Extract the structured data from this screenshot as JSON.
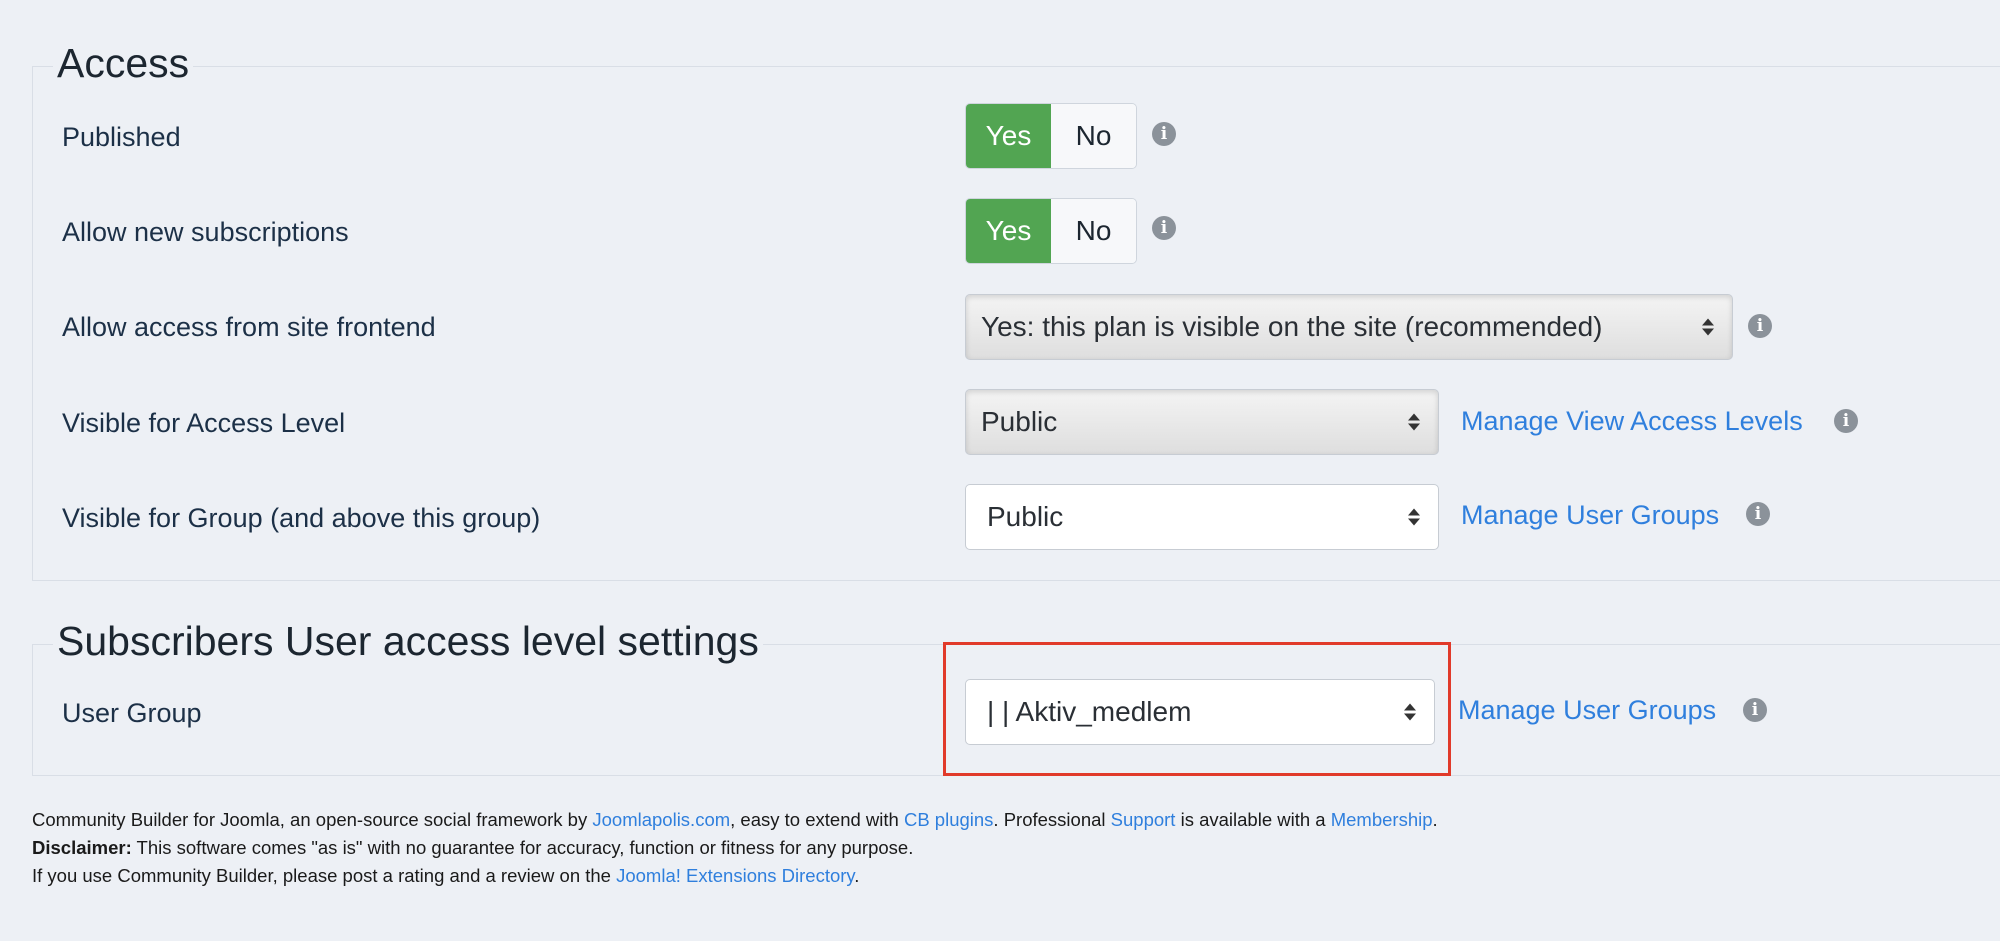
{
  "access": {
    "legend": "Access",
    "published": {
      "label": "Published",
      "yes": "Yes",
      "no": "No",
      "selected": "Yes"
    },
    "allow_new_subscriptions": {
      "label": "Allow new subscriptions",
      "yes": "Yes",
      "no": "No",
      "selected": "Yes"
    },
    "allow_access_frontend": {
      "label": "Allow access from site frontend",
      "value": "Yes: this plan is visible on the site (recommended)"
    },
    "visible_access_level": {
      "label": "Visible for Access Level",
      "value": "Public",
      "link": "Manage View Access Levels"
    },
    "visible_group": {
      "label": "Visible for Group (and above this group)",
      "value": "Public",
      "link": "Manage User Groups"
    }
  },
  "subscribers": {
    "legend": "Subscribers User access level settings",
    "user_group": {
      "label": "User Group",
      "value": "| | Aktiv_medlem",
      "link": "Manage User Groups"
    }
  },
  "footer": {
    "line1_prefix": "Community Builder for Joomla, an open-source social framework by ",
    "line1_link1": "Joomlapolis.com",
    "line1_mid1": ", easy to extend with ",
    "line1_link2": "CB plugins",
    "line1_mid2": ". Professional ",
    "line1_link3": "Support",
    "line1_mid3": " is available with a ",
    "line1_link4": "Membership",
    "line1_end": ".",
    "disclaimer_bold": "Disclaimer:",
    "disclaimer_text": " This software comes \"as is\" with no guarantee for accuracy, function or fitness for any purpose.",
    "line3_prefix": "If you use Community Builder, please post a rating and a review on the ",
    "line3_link": "Joomla! Extensions Directory",
    "line3_end": "."
  },
  "icons": {
    "info": "info-icon",
    "select_arrows": "select-arrows-icon"
  },
  "colors": {
    "background": "#edf0f5",
    "yes_active": "#52a552",
    "link": "#2f7fdd",
    "highlight": "#e13a2a"
  }
}
